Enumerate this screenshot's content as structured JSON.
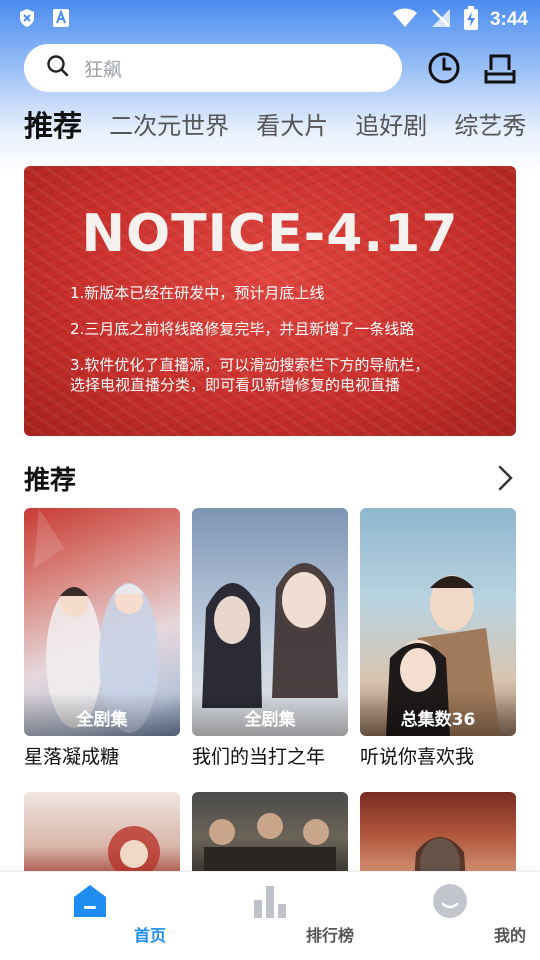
{
  "status_bar": {
    "time": "3:44",
    "icons": [
      "shield-icon",
      "a-app-icon",
      "wifi-icon",
      "no-signal-icon",
      "battery-charging-icon"
    ]
  },
  "search": {
    "placeholder": "狂飙",
    "icons": [
      "search-icon",
      "history-clock-icon",
      "download-tray-icon"
    ]
  },
  "tabs": [
    {
      "label": "推荐",
      "active": true
    },
    {
      "label": "二次元世界",
      "active": false
    },
    {
      "label": "看大片",
      "active": false
    },
    {
      "label": "追好剧",
      "active": false
    },
    {
      "label": "综艺秀",
      "active": false
    }
  ],
  "banner": {
    "title": "NOTICE-4.17",
    "lines": [
      "1.新版本已经在研发中，预计月底上线",
      "2.三月底之前将线路修复完毕，并且新增了一条线路",
      "3.软件优化了直播源，可以滑动搜索栏下方的导航栏，",
      "选择电视直播分类，即可看见新增修复的电视直播"
    ]
  },
  "section": {
    "title": "推荐",
    "more_icon": "chevron-right-icon"
  },
  "cards": [
    {
      "title": "星落凝成糖",
      "badge": "全剧集"
    },
    {
      "title": "我们的当打之年",
      "badge": "全剧集"
    },
    {
      "title": "听说你喜欢我",
      "badge": "总集数36"
    }
  ],
  "bottom_nav": [
    {
      "label": "首页",
      "icon": "home-icon",
      "active": true
    },
    {
      "label": "排行榜",
      "icon": "ranking-bars-icon",
      "active": false
    },
    {
      "label": "我的",
      "icon": "profile-face-icon",
      "active": false
    }
  ],
  "colors": {
    "accent": "#1e8cf0",
    "inactive": "#555555",
    "banner_red": "#c9302c"
  }
}
